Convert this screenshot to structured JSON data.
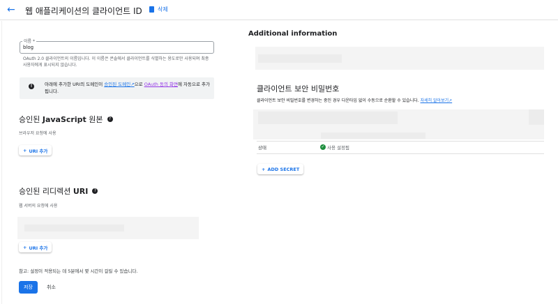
{
  "header": {
    "title": "웹 애플리케이션의 클라이언트 ID",
    "delete_label": "삭제"
  },
  "name_field": {
    "label": "이름 *",
    "value": "blog",
    "help": "OAuth 2.0 클라이언트의 이름입니다. 이 이름은 콘솔에서 클라이언트를 식별하는 용도로만 사용되며 최종 사용자에게 표시되지 않습니다."
  },
  "info": {
    "pre": "아래에 추가한 URI의 도메인이 ",
    "link1": "승인된 도메인",
    "mid": "으로 ",
    "link2": "OAuth 동의 화면",
    "post": "에 자동으로 추가됩니다."
  },
  "js_origins": {
    "title_pre": "승인된 ",
    "title_bold": "JavaScript",
    "title_post": " 원본",
    "subtitle": "브라우저 요청에 사용",
    "add_label": "URI 추가"
  },
  "redirect": {
    "title_pre": "승인된 리디렉션 ",
    "title_bold": "URI",
    "subtitle": "웹 서버의 요청에 사용",
    "add_label": "URI 추가"
  },
  "note": "참고: 설정이 적용되는 데 5분에서 몇 시간이 걸릴 수 있습니다.",
  "actions": {
    "save": "저장",
    "cancel": "취소"
  },
  "additional": {
    "title": "Additional information"
  },
  "secret": {
    "title": "클라이언트 보안 비밀번호",
    "desc": "클라이언트 보안 비밀번호를 변경하는 중인 경우 다운타임 없이 수동으로 순환할 수 있습니다. ",
    "learn_more": "자세히 알아보기",
    "status_label": "상태",
    "status_value": "사용 설정됨",
    "add_secret": "ADD SECRET"
  }
}
